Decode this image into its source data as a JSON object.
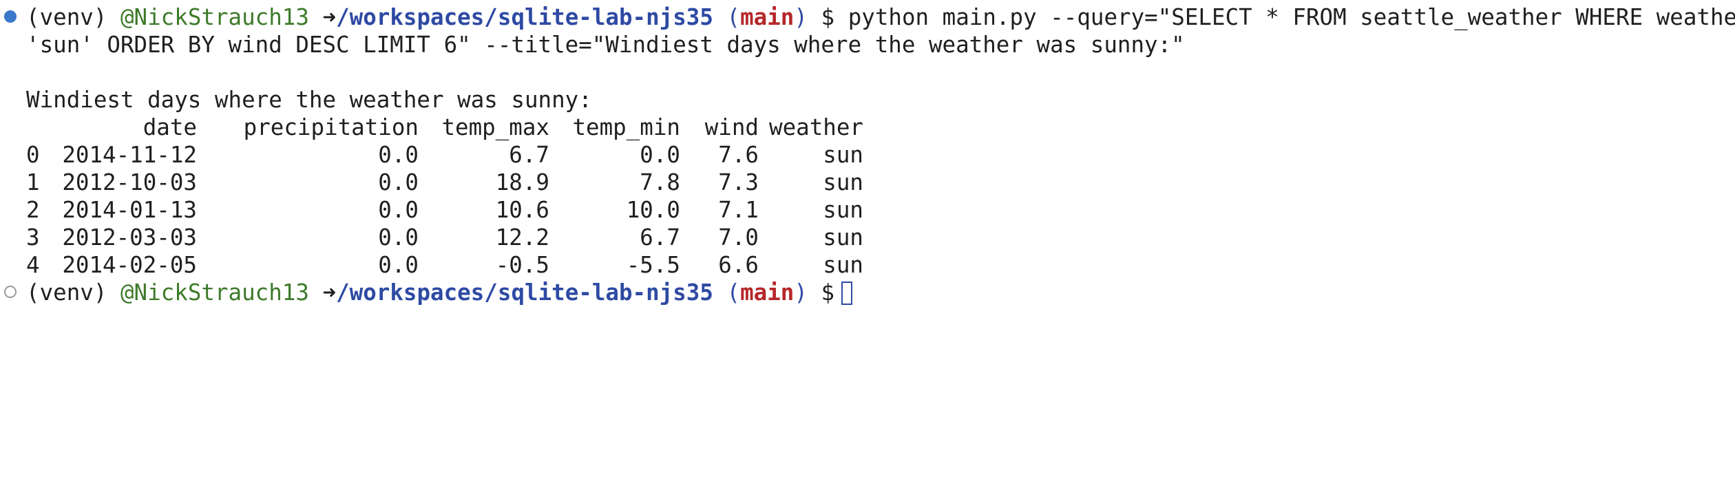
{
  "prompt": {
    "venv": "(venv)",
    "user": "@NickStrauch13",
    "arrow": "➜",
    "path": "/workspaces/sqlite-lab-njs35",
    "branch_open": "(",
    "branch": "main",
    "branch_close": ")",
    "symbol": "$"
  },
  "command": {
    "line1": "python main.py --query=\"SELECT * FROM seattle_weather WHERE weather=",
    "line2": "'sun' ORDER BY wind DESC LIMIT 6\" --title=\"Windiest days where the weather was sunny:\""
  },
  "output": {
    "title": "Windiest days where the weather was sunny:",
    "columns": [
      "date",
      "precipitation",
      "temp_max",
      "temp_min",
      "wind",
      "weather"
    ],
    "rows": [
      {
        "index": "0",
        "date": "2014-11-12",
        "precipitation": "0.0",
        "temp_max": "6.7",
        "temp_min": "0.0",
        "wind": "7.6",
        "weather": "sun"
      },
      {
        "index": "1",
        "date": "2012-10-03",
        "precipitation": "0.0",
        "temp_max": "18.9",
        "temp_min": "7.8",
        "wind": "7.3",
        "weather": "sun"
      },
      {
        "index": "2",
        "date": "2014-01-13",
        "precipitation": "0.0",
        "temp_max": "10.6",
        "temp_min": "10.0",
        "wind": "7.1",
        "weather": "sun"
      },
      {
        "index": "3",
        "date": "2012-03-03",
        "precipitation": "0.0",
        "temp_max": "12.2",
        "temp_min": "6.7",
        "wind": "7.0",
        "weather": "sun"
      },
      {
        "index": "4",
        "date": "2014-02-05",
        "precipitation": "0.0",
        "temp_max": "-0.5",
        "temp_min": "-5.5",
        "wind": "6.6",
        "weather": "sun"
      }
    ]
  },
  "colors": {
    "decoration_success": "#3a78c9",
    "decoration_pending": "#9a9a9a",
    "user": "#3d7a2a",
    "path": "#2e4aa3",
    "branch": "#b5282a"
  }
}
